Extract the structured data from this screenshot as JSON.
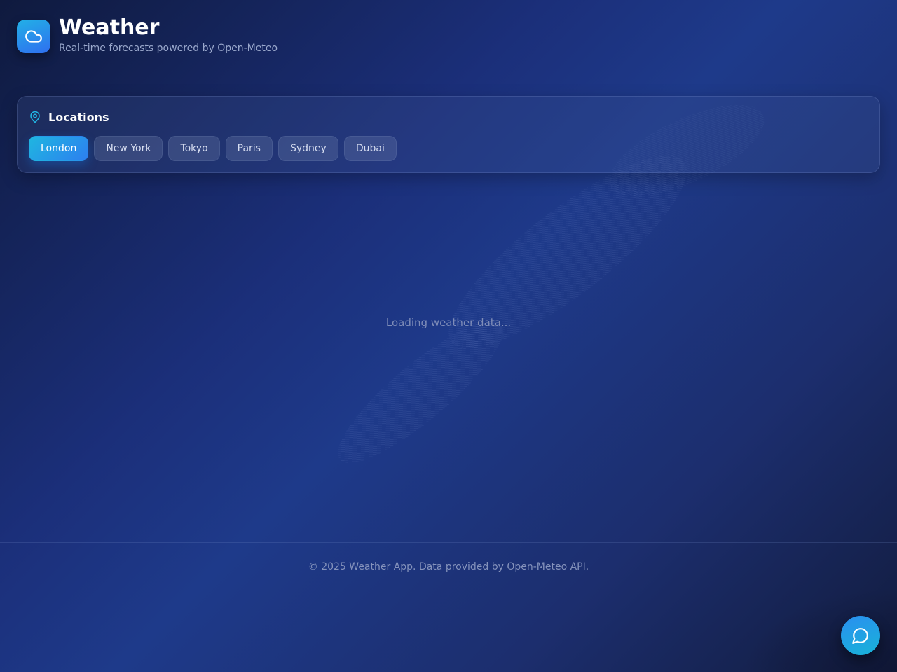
{
  "header": {
    "title": "Weather",
    "subtitle": "Real-time forecasts powered by Open-Meteo",
    "logo_icon": "cloud-icon"
  },
  "locations": {
    "title": "Locations",
    "icon": "map-pin-icon",
    "items": [
      {
        "label": "London",
        "active": true
      },
      {
        "label": "New York",
        "active": false
      },
      {
        "label": "Tokyo",
        "active": false
      },
      {
        "label": "Paris",
        "active": false
      },
      {
        "label": "Sydney",
        "active": false
      },
      {
        "label": "Dubai",
        "active": false
      }
    ]
  },
  "main": {
    "loading_text": "Loading weather data..."
  },
  "footer": {
    "text": "© 2025 Weather App. Data provided by Open-Meteo API."
  },
  "chat": {
    "icon": "chat-bubble-icon"
  },
  "colors": {
    "accent": "#1fb6e0",
    "accent_secondary": "#2d7ff0",
    "background": "#1e3a8a"
  }
}
